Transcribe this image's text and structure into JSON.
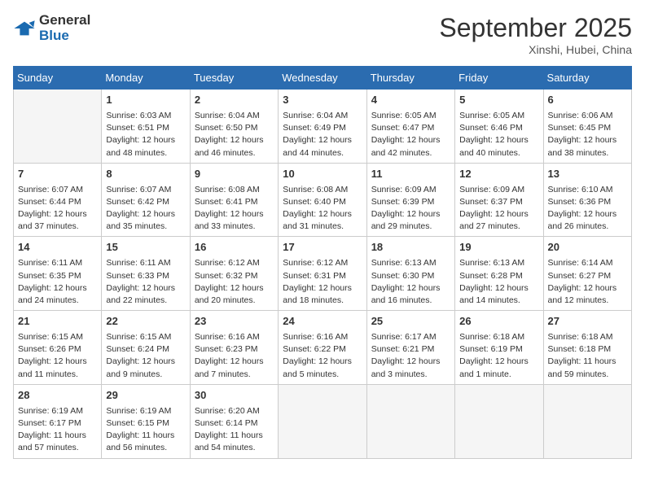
{
  "header": {
    "logo_line1": "General",
    "logo_line2": "Blue",
    "month": "September 2025",
    "location": "Xinshi, Hubei, China"
  },
  "weekdays": [
    "Sunday",
    "Monday",
    "Tuesday",
    "Wednesday",
    "Thursday",
    "Friday",
    "Saturday"
  ],
  "weeks": [
    [
      {
        "day": "",
        "content": ""
      },
      {
        "day": "1",
        "content": "Sunrise: 6:03 AM\nSunset: 6:51 PM\nDaylight: 12 hours\nand 48 minutes."
      },
      {
        "day": "2",
        "content": "Sunrise: 6:04 AM\nSunset: 6:50 PM\nDaylight: 12 hours\nand 46 minutes."
      },
      {
        "day": "3",
        "content": "Sunrise: 6:04 AM\nSunset: 6:49 PM\nDaylight: 12 hours\nand 44 minutes."
      },
      {
        "day": "4",
        "content": "Sunrise: 6:05 AM\nSunset: 6:47 PM\nDaylight: 12 hours\nand 42 minutes."
      },
      {
        "day": "5",
        "content": "Sunrise: 6:05 AM\nSunset: 6:46 PM\nDaylight: 12 hours\nand 40 minutes."
      },
      {
        "day": "6",
        "content": "Sunrise: 6:06 AM\nSunset: 6:45 PM\nDaylight: 12 hours\nand 38 minutes."
      }
    ],
    [
      {
        "day": "7",
        "content": "Sunrise: 6:07 AM\nSunset: 6:44 PM\nDaylight: 12 hours\nand 37 minutes."
      },
      {
        "day": "8",
        "content": "Sunrise: 6:07 AM\nSunset: 6:42 PM\nDaylight: 12 hours\nand 35 minutes."
      },
      {
        "day": "9",
        "content": "Sunrise: 6:08 AM\nSunset: 6:41 PM\nDaylight: 12 hours\nand 33 minutes."
      },
      {
        "day": "10",
        "content": "Sunrise: 6:08 AM\nSunset: 6:40 PM\nDaylight: 12 hours\nand 31 minutes."
      },
      {
        "day": "11",
        "content": "Sunrise: 6:09 AM\nSunset: 6:39 PM\nDaylight: 12 hours\nand 29 minutes."
      },
      {
        "day": "12",
        "content": "Sunrise: 6:09 AM\nSunset: 6:37 PM\nDaylight: 12 hours\nand 27 minutes."
      },
      {
        "day": "13",
        "content": "Sunrise: 6:10 AM\nSunset: 6:36 PM\nDaylight: 12 hours\nand 26 minutes."
      }
    ],
    [
      {
        "day": "14",
        "content": "Sunrise: 6:11 AM\nSunset: 6:35 PM\nDaylight: 12 hours\nand 24 minutes."
      },
      {
        "day": "15",
        "content": "Sunrise: 6:11 AM\nSunset: 6:33 PM\nDaylight: 12 hours\nand 22 minutes."
      },
      {
        "day": "16",
        "content": "Sunrise: 6:12 AM\nSunset: 6:32 PM\nDaylight: 12 hours\nand 20 minutes."
      },
      {
        "day": "17",
        "content": "Sunrise: 6:12 AM\nSunset: 6:31 PM\nDaylight: 12 hours\nand 18 minutes."
      },
      {
        "day": "18",
        "content": "Sunrise: 6:13 AM\nSunset: 6:30 PM\nDaylight: 12 hours\nand 16 minutes."
      },
      {
        "day": "19",
        "content": "Sunrise: 6:13 AM\nSunset: 6:28 PM\nDaylight: 12 hours\nand 14 minutes."
      },
      {
        "day": "20",
        "content": "Sunrise: 6:14 AM\nSunset: 6:27 PM\nDaylight: 12 hours\nand 12 minutes."
      }
    ],
    [
      {
        "day": "21",
        "content": "Sunrise: 6:15 AM\nSunset: 6:26 PM\nDaylight: 12 hours\nand 11 minutes."
      },
      {
        "day": "22",
        "content": "Sunrise: 6:15 AM\nSunset: 6:24 PM\nDaylight: 12 hours\nand 9 minutes."
      },
      {
        "day": "23",
        "content": "Sunrise: 6:16 AM\nSunset: 6:23 PM\nDaylight: 12 hours\nand 7 minutes."
      },
      {
        "day": "24",
        "content": "Sunrise: 6:16 AM\nSunset: 6:22 PM\nDaylight: 12 hours\nand 5 minutes."
      },
      {
        "day": "25",
        "content": "Sunrise: 6:17 AM\nSunset: 6:21 PM\nDaylight: 12 hours\nand 3 minutes."
      },
      {
        "day": "26",
        "content": "Sunrise: 6:18 AM\nSunset: 6:19 PM\nDaylight: 12 hours\nand 1 minute."
      },
      {
        "day": "27",
        "content": "Sunrise: 6:18 AM\nSunset: 6:18 PM\nDaylight: 11 hours\nand 59 minutes."
      }
    ],
    [
      {
        "day": "28",
        "content": "Sunrise: 6:19 AM\nSunset: 6:17 PM\nDaylight: 11 hours\nand 57 minutes."
      },
      {
        "day": "29",
        "content": "Sunrise: 6:19 AM\nSunset: 6:15 PM\nDaylight: 11 hours\nand 56 minutes."
      },
      {
        "day": "30",
        "content": "Sunrise: 6:20 AM\nSunset: 6:14 PM\nDaylight: 11 hours\nand 54 minutes."
      },
      {
        "day": "",
        "content": ""
      },
      {
        "day": "",
        "content": ""
      },
      {
        "day": "",
        "content": ""
      },
      {
        "day": "",
        "content": ""
      }
    ]
  ]
}
